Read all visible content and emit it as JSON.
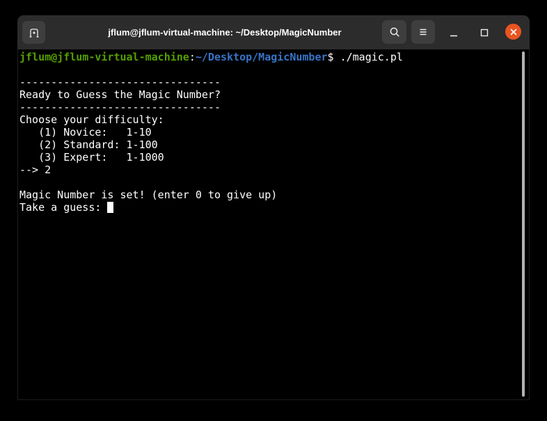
{
  "window": {
    "title": "jflum@jflum-virtual-machine: ~/Desktop/MagicNumber",
    "controls": {
      "new_tab": "new-tab",
      "search": "search",
      "menu": "menu",
      "minimize": "minimize",
      "maximize": "maximize",
      "close": "close"
    }
  },
  "colors": {
    "titlebar_bg": "#2c2c2c",
    "titlebar_button_bg": "#3e3e3e",
    "close_button": "#E95420",
    "icon": "#ededed",
    "terminal_bg": "#000000",
    "window_border": "#1e1e1e",
    "white": "#ffffff",
    "green": "#55A000",
    "blue": "#3874C8",
    "scrollbar": "#b3b3b3",
    "cursor": "#ffffff"
  },
  "terminal": {
    "lines": [
      {
        "segments": [
          {
            "text": "jflum@jflum-virtual-machine",
            "color": "green",
            "bold": true
          },
          {
            "text": ":",
            "color": "white"
          },
          {
            "text": "~/Desktop/MagicNumber",
            "color": "blue",
            "bold": true
          },
          {
            "text": "$ ./magic.pl",
            "color": "white"
          }
        ]
      },
      {
        "segments": []
      },
      {
        "segments": [
          {
            "text": "--------------------------------",
            "color": "white"
          }
        ]
      },
      {
        "segments": [
          {
            "text": "Ready to Guess the Magic Number?",
            "color": "white"
          }
        ]
      },
      {
        "segments": [
          {
            "text": "--------------------------------",
            "color": "white"
          }
        ]
      },
      {
        "segments": [
          {
            "text": "Choose your difficulty:",
            "color": "white"
          }
        ]
      },
      {
        "segments": [
          {
            "text": "   (1) Novice:   1-10",
            "color": "white"
          }
        ]
      },
      {
        "segments": [
          {
            "text": "   (2) Standard: 1-100",
            "color": "white"
          }
        ]
      },
      {
        "segments": [
          {
            "text": "   (3) Expert:   1-1000",
            "color": "white"
          }
        ]
      },
      {
        "segments": [
          {
            "text": "--> 2",
            "color": "white"
          }
        ]
      },
      {
        "segments": []
      },
      {
        "segments": [
          {
            "text": "Magic Number is set! (enter 0 to give up)",
            "color": "white"
          }
        ]
      },
      {
        "segments": [
          {
            "text": "Take a guess: ",
            "color": "white"
          }
        ],
        "cursor": true
      }
    ]
  }
}
